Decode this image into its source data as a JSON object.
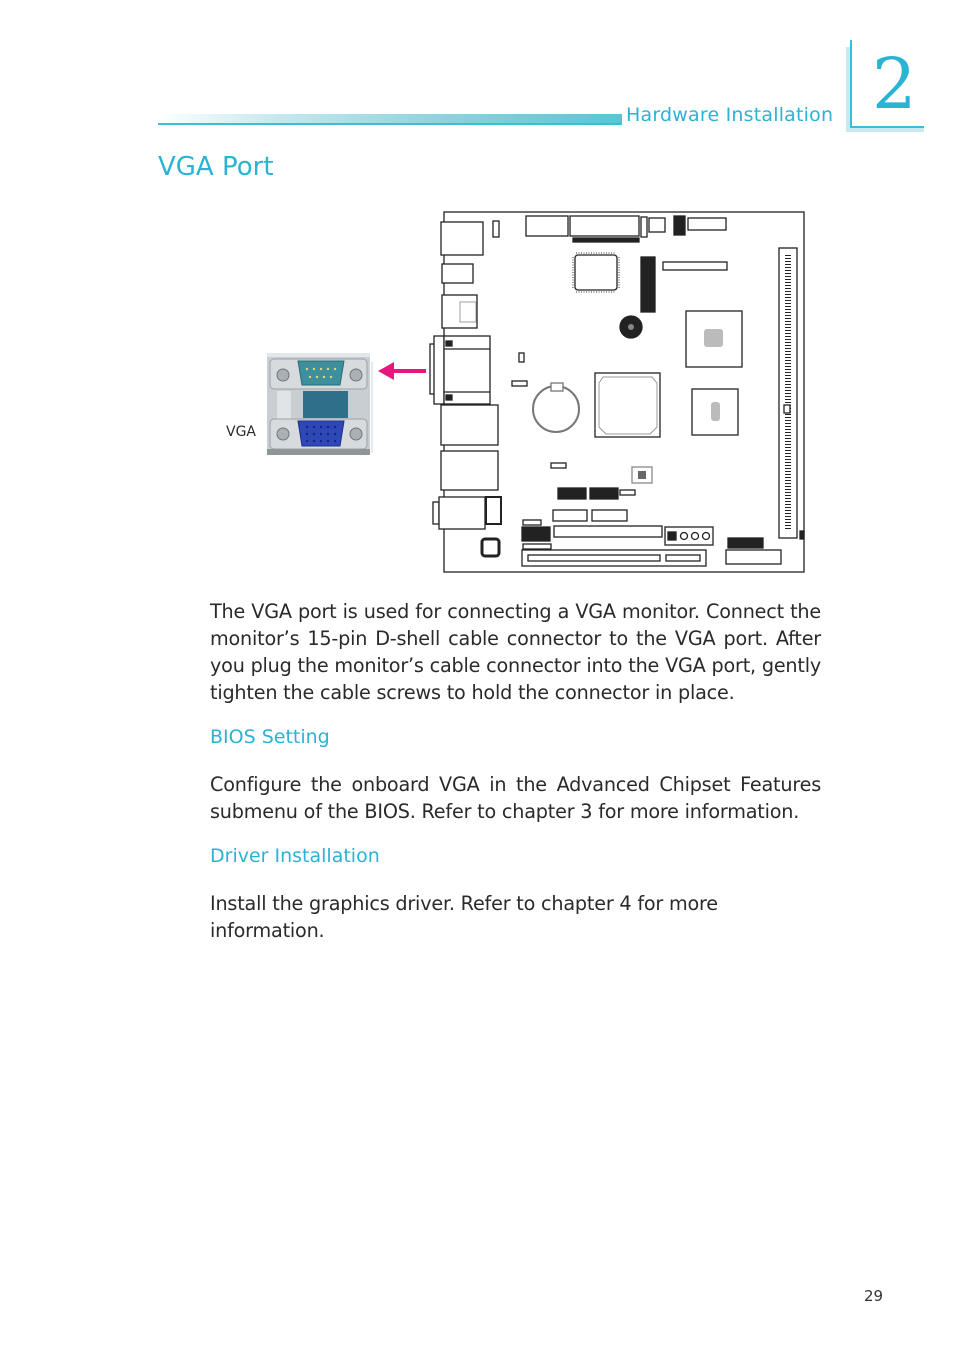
{
  "header": {
    "section_title": "Hardware Installation",
    "chapter_number": "2"
  },
  "page_title": "VGA Port",
  "figure": {
    "port_label": "VGA",
    "arrow_color": "#e6177f",
    "board_description": "Motherboard layout diagram with VGA port location indicated",
    "io_panel_description": "Rear I/O panel showing COM (DB-9) port above and blue VGA (DB-15) port below"
  },
  "sections": [
    {
      "type": "paragraph",
      "text": "The VGA port is used for connecting a VGA monitor. Connect the monitor’s 15-pin D-shell cable connector to the VGA port. After you plug the monitor’s cable connector into the VGA port, gently tighten the cable screws to hold the connector in place."
    },
    {
      "type": "subheading",
      "text": "BIOS Setting"
    },
    {
      "type": "paragraph",
      "text": "Configure the onboard VGA in the Advanced Chipset Features submenu of the BIOS. Refer to chapter 3 for more information."
    },
    {
      "type": "subheading",
      "text": "Driver Installation"
    },
    {
      "type": "paragraph",
      "text": "Install the graphics driver. Refer to chapter 4 for more information."
    }
  ],
  "page_number": "29",
  "colors": {
    "accent": "#2ab3d3",
    "text": "#2a2a2a",
    "arrow": "#e6177f",
    "vga_port": "#2f48b8"
  }
}
